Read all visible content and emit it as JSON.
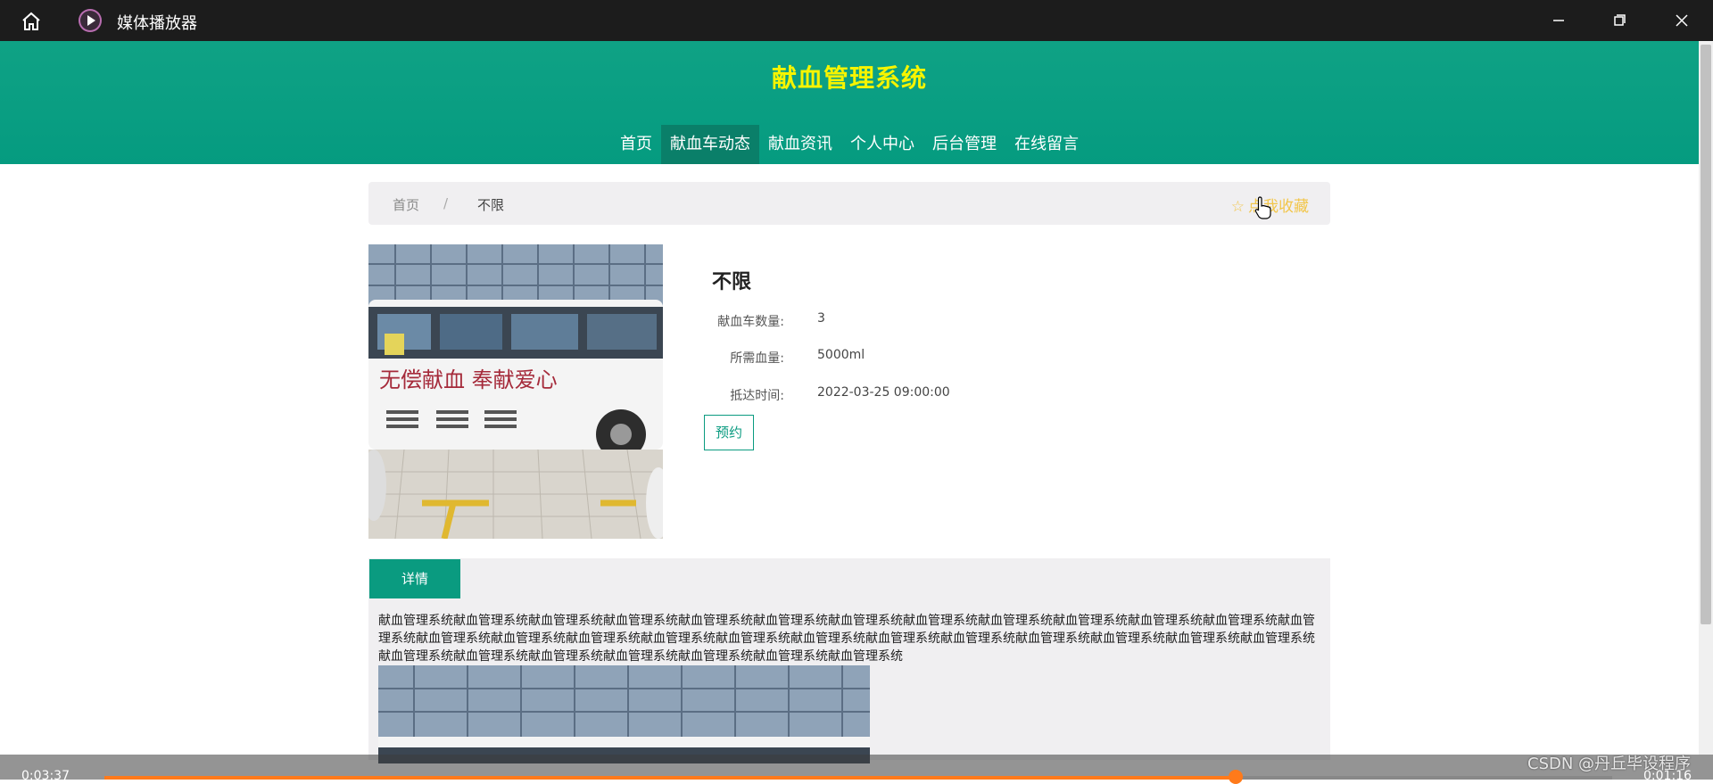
{
  "window": {
    "title": "媒体播放器",
    "home_icon": "home-icon",
    "app_icon": "media-player-icon",
    "controls": [
      "minimize-icon",
      "maximize-icon",
      "close-icon"
    ]
  },
  "site": {
    "title": "献血管理系统",
    "nav": [
      {
        "label": "首页"
      },
      {
        "label": "献血车动态"
      },
      {
        "label": "献血资讯"
      },
      {
        "label": "个人中心"
      },
      {
        "label": "后台管理"
      },
      {
        "label": "在线留言"
      }
    ],
    "active_nav": "献血车动态"
  },
  "breadcrumb": {
    "home": "首页",
    "separator": "/",
    "current": "不限"
  },
  "favorite": {
    "icon": "star-icon",
    "label": "点我收藏",
    "color": "#f2c64a"
  },
  "item": {
    "title": "不限",
    "fields": [
      {
        "label": "献血车数量:",
        "value": "3"
      },
      {
        "label": "所需血量:",
        "value": "5000ml"
      },
      {
        "label": "抵达时间:",
        "value": "2022-03-25 09:00:00"
      }
    ],
    "reserve_label": "预约",
    "cover_text": "无偿献血 奉献爱心"
  },
  "tabs": {
    "active": "详情"
  },
  "detail": {
    "text": "献血管理系统献血管理系统献血管理系统献血管理系统献血管理系统献血管理系统献血管理系统献血管理系统献血管理系统献血管理系统献血管理系统献血管理系统献血管理系统献血管理系统献血管理系统献血管理系统献血管理系统献血管理系统献血管理系统献血管理系统献血管理系统献血管理系统献血管理系统献血管理系统献血管理系统献血管理系统献血管理系统献血管理系统献血管理系统献血管理系统献血管理系统献血管理系统"
  },
  "player": {
    "elapsed": "0:03:37",
    "remaining": "0:01:16",
    "progress_percent": 75
  },
  "watermark": "CSDN @丹丘毕设程序",
  "colors": {
    "header": "#0a9b80",
    "site_title": "#f6f400",
    "accent": "#0a9b80",
    "progress": "#ff7a1a"
  }
}
